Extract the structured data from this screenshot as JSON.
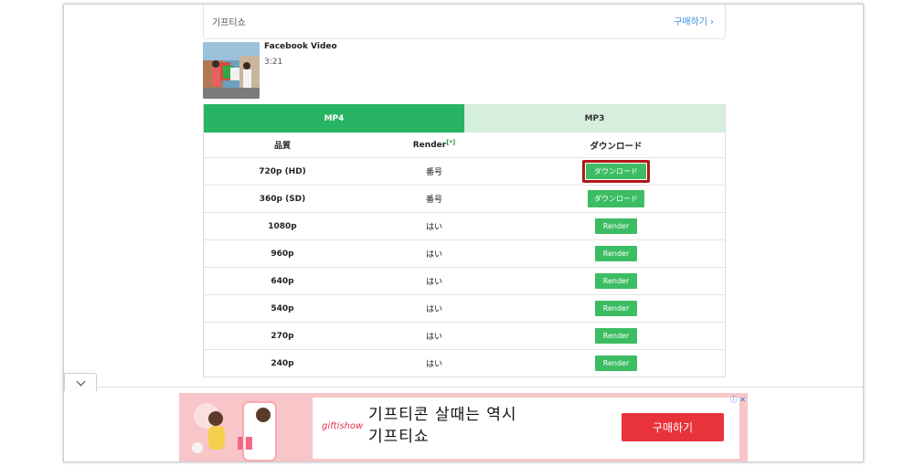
{
  "ad_top": {
    "brand": "기프티쇼",
    "buy_label": "구매하기",
    "buy_chevron": "›"
  },
  "video": {
    "title": "Facebook Video",
    "duration": "3:21"
  },
  "tabs": [
    {
      "label": "MP4"
    },
    {
      "label": "MP3"
    }
  ],
  "table": {
    "headers": {
      "quality": "品質",
      "render": "Render",
      "render_sup": "[*]",
      "download": "ダウンロード"
    },
    "rows": [
      {
        "quality": "720p (HD)",
        "render": "番号",
        "action": "ダウンロード"
      },
      {
        "quality": "360p (SD)",
        "render": "番号",
        "action": "ダウンロード"
      },
      {
        "quality": "1080p",
        "render": "はい",
        "action": "Render"
      },
      {
        "quality": "960p",
        "render": "はい",
        "action": "Render"
      },
      {
        "quality": "640p",
        "render": "はい",
        "action": "Render"
      },
      {
        "quality": "540p",
        "render": "はい",
        "action": "Render"
      },
      {
        "quality": "270p",
        "render": "はい",
        "action": "Render"
      },
      {
        "quality": "240p",
        "render": "はい",
        "action": "Render"
      }
    ]
  },
  "ad_bottom": {
    "brand": "giftishow",
    "headline_line1": "기프티콘 살때는 역시",
    "headline_line2": "기프티쇼",
    "cta_label": "구매하기",
    "adchoices": "ⓘ ✕"
  },
  "colors": {
    "green": "#27b463",
    "light_green": "#d6eedd",
    "highlight": "#b01919",
    "ad_red": "#e8333b",
    "ad_pink": "#f8c6c8"
  }
}
